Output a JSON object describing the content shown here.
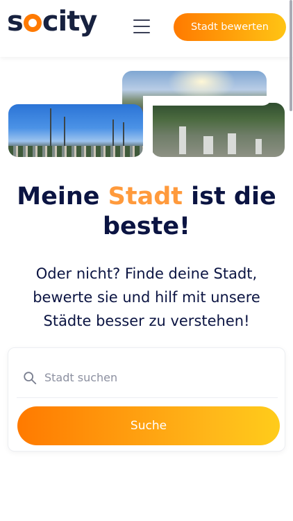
{
  "header": {
    "logo_text_left": "s",
    "logo_text_right": "city",
    "rate_button_label": "Stadt bewerten"
  },
  "hero": {
    "title_part1": "Meine ",
    "title_accent": "Stadt",
    "title_part2": " ist die beste!",
    "subtitle": "Oder nicht? Finde deine Stadt, bewerte sie und hilf mit unsere Städte besser zu verstehen!"
  },
  "search": {
    "placeholder": "Stadt suchen",
    "value": "",
    "submit_label": "Suche"
  },
  "colors": {
    "brand_orange": "#ff7a00",
    "brand_yellow": "#ffc414",
    "navy": "#0b1442",
    "accent_text": "#ff9a3c"
  },
  "icons": {
    "menu": "hamburger-menu-icon",
    "search": "search-icon"
  }
}
